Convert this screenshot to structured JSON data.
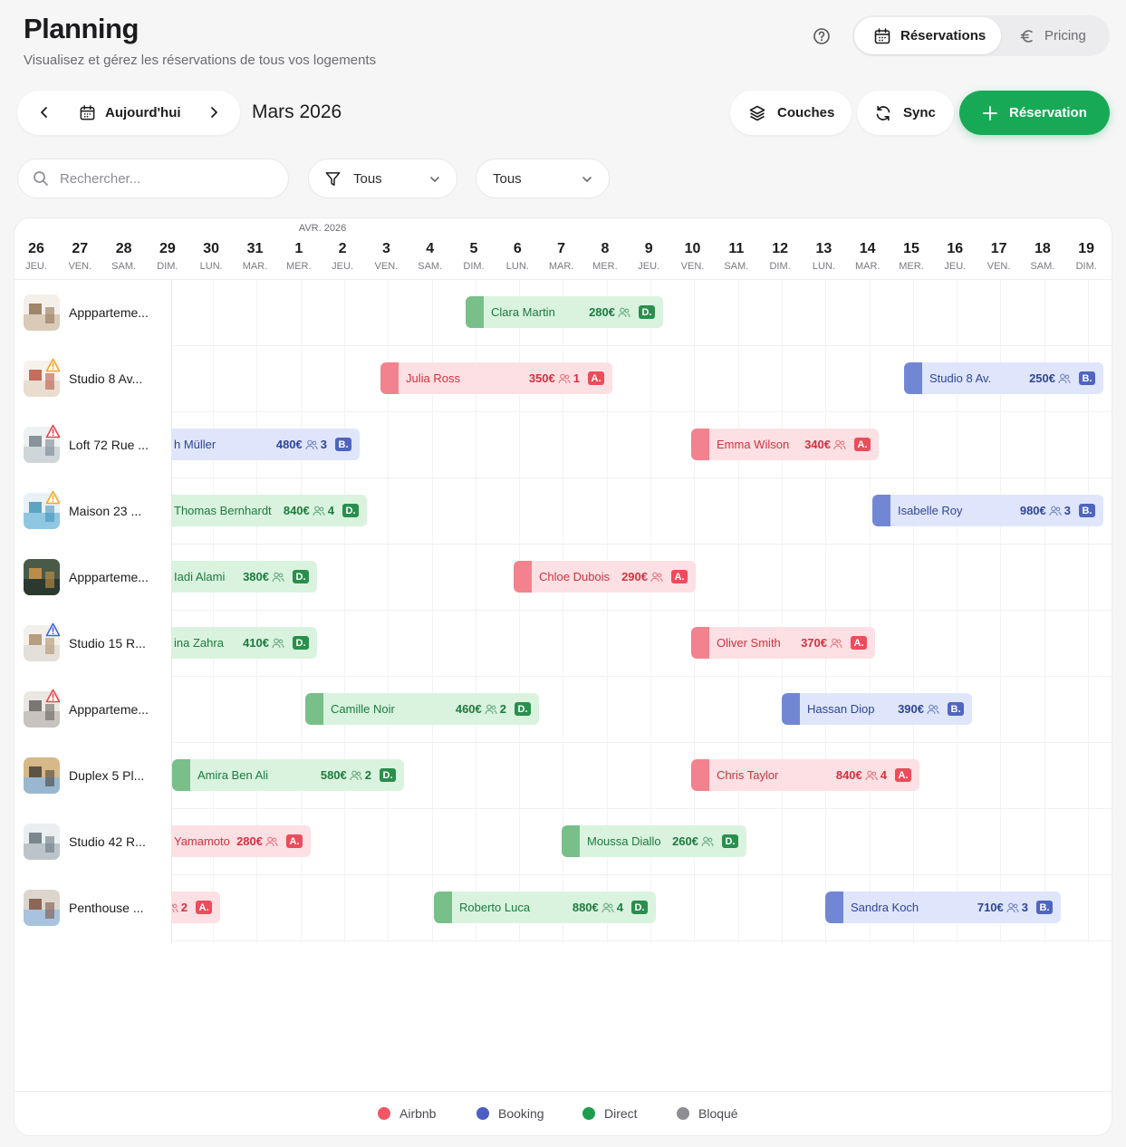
{
  "header": {
    "title": "Planning",
    "subtitle": "Visualisez et gérez les réservations de tous vos logements",
    "tabs": [
      {
        "label": "Réservations",
        "icon": "calendar-icon",
        "active": true
      },
      {
        "label": "Pricing",
        "icon": "euro-icon",
        "active": false
      }
    ]
  },
  "toolbar": {
    "today_label": "Aujourd'hui",
    "month_label": "Mars 2026",
    "layers_label": "Couches",
    "sync_label": "Sync",
    "new_label": "Réservation"
  },
  "filters": {
    "search_placeholder": "Rechercher...",
    "filter1_value": "Tous",
    "filter2_value": "Tous"
  },
  "calendar": {
    "month_marker": "AVR. 2026",
    "days": [
      {
        "n": "26",
        "w": "JEU."
      },
      {
        "n": "27",
        "w": "VEN."
      },
      {
        "n": "28",
        "w": "SAM."
      },
      {
        "n": "29",
        "w": "DIM."
      },
      {
        "n": "30",
        "w": "LUN."
      },
      {
        "n": "31",
        "w": "MAR."
      },
      {
        "n": "1",
        "w": "MER."
      },
      {
        "n": "2",
        "w": "JEU."
      },
      {
        "n": "3",
        "w": "VEN."
      },
      {
        "n": "4",
        "w": "SAM."
      },
      {
        "n": "5",
        "w": "DIM."
      },
      {
        "n": "6",
        "w": "LUN."
      },
      {
        "n": "7",
        "w": "MAR."
      },
      {
        "n": "8",
        "w": "MER."
      },
      {
        "n": "9",
        "w": "JEU."
      },
      {
        "n": "10",
        "w": "VEN."
      },
      {
        "n": "11",
        "w": "SAM."
      },
      {
        "n": "12",
        "w": "DIM."
      },
      {
        "n": "13",
        "w": "LUN."
      },
      {
        "n": "14",
        "w": "MAR."
      },
      {
        "n": "15",
        "w": "MER."
      },
      {
        "n": "16",
        "w": "JEU."
      },
      {
        "n": "17",
        "w": "VEN."
      },
      {
        "n": "18",
        "w": "SAM."
      },
      {
        "n": "19",
        "w": "DIM."
      }
    ]
  },
  "properties": [
    {
      "name": "Appparteme...",
      "warning": null
    },
    {
      "name": "Studio 8 Av...",
      "warning": "warning-icon"
    },
    {
      "name": "Loft 72 Rue ...",
      "warning": "alert-icon"
    },
    {
      "name": "Maison 23 ...",
      "warning": "warning-icon"
    },
    {
      "name": "Appparteme...",
      "warning": null
    },
    {
      "name": "Studio 15 R...",
      "warning": "info-warning-icon"
    },
    {
      "name": "Appparteme...",
      "warning": "alert-icon"
    },
    {
      "name": "Duplex 5 Pl...",
      "warning": null
    },
    {
      "name": "Studio 42 R...",
      "warning": null
    },
    {
      "name": "Penthouse ...",
      "warning": null
    }
  ],
  "reservations": [
    {
      "row": 0,
      "guest": "Clara Martin",
      "price": "280€",
      "guests": "",
      "badge": "D.",
      "source": "direct"
    },
    {
      "row": 1,
      "guest": "Julia Ross",
      "price": "350€",
      "guests": "1",
      "badge": "A.",
      "source": "airbnb"
    },
    {
      "row": 1,
      "guest": "Studio 8 Av.",
      "price": "250€",
      "guests": "",
      "badge": "B.",
      "source": "booking"
    },
    {
      "row": 2,
      "guest": "h Müller",
      "price": "480€",
      "guests": "3",
      "badge": "B.",
      "source": "booking"
    },
    {
      "row": 2,
      "guest": "Emma Wilson",
      "price": "340€",
      "guests": "",
      "badge": "A.",
      "source": "airbnb"
    },
    {
      "row": 3,
      "guest": "Thomas Bernhardt",
      "price": "840€",
      "guests": "4",
      "badge": "D.",
      "source": "direct"
    },
    {
      "row": 3,
      "guest": "Isabelle Roy",
      "price": "980€",
      "guests": "3",
      "badge": "B.",
      "source": "booking"
    },
    {
      "row": 4,
      "guest": "Iadi Alami",
      "price": "380€",
      "guests": "",
      "badge": "D.",
      "source": "direct"
    },
    {
      "row": 4,
      "guest": "Chloe Dubois",
      "price": "290€",
      "guests": "",
      "badge": "A.",
      "source": "airbnb"
    },
    {
      "row": 5,
      "guest": "ina Zahra",
      "price": "410€",
      "guests": "",
      "badge": "D.",
      "source": "direct"
    },
    {
      "row": 5,
      "guest": "Oliver Smith",
      "price": "370€",
      "guests": "",
      "badge": "A.",
      "source": "airbnb"
    },
    {
      "row": 6,
      "guest": "Camille Noir",
      "price": "460€",
      "guests": "2",
      "badge": "D.",
      "source": "direct"
    },
    {
      "row": 6,
      "guest": "Hassan Diop",
      "price": "390€",
      "guests": "",
      "badge": "B.",
      "source": "booking"
    },
    {
      "row": 7,
      "guest": "Amira Ben Ali",
      "price": "580€",
      "guests": "2",
      "badge": "D.",
      "source": "direct"
    },
    {
      "row": 7,
      "guest": "Chris Taylor",
      "price": "840€",
      "guests": "4",
      "badge": "A.",
      "source": "airbnb"
    },
    {
      "row": 8,
      "guest": "Yamamoto",
      "price": "280€",
      "guests": "",
      "badge": "A.",
      "source": "airbnb"
    },
    {
      "row": 8,
      "guest": "Moussa Diallo",
      "price": "260€",
      "guests": "",
      "badge": "D.",
      "source": "direct"
    },
    {
      "row": 9,
      "guest": "",
      "price": "",
      "guests": "2",
      "badge": "A.",
      "source": "airbnb"
    },
    {
      "row": 9,
      "guest": "Roberto Luca",
      "price": "880€",
      "guests": "4",
      "badge": "D.",
      "source": "direct"
    },
    {
      "row": 9,
      "guest": "Sandra Koch",
      "price": "710€",
      "guests": "3",
      "badge": "B.",
      "source": "booking"
    }
  ],
  "legend": [
    {
      "label": "Airbnb",
      "color": "#ef5765"
    },
    {
      "label": "Booking",
      "color": "#4a5fc1"
    },
    {
      "label": "Direct",
      "color": "#1e9e4f"
    },
    {
      "label": "Bloqué",
      "color": "#8e8e93"
    }
  ]
}
